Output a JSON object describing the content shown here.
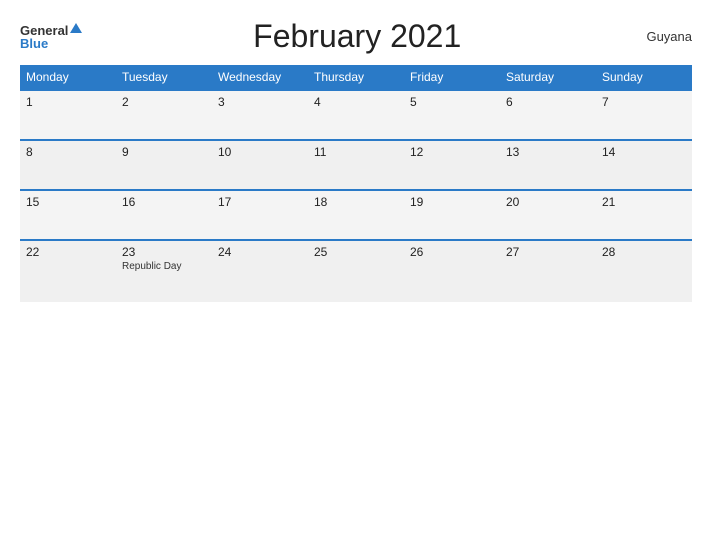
{
  "header": {
    "logo_general": "General",
    "logo_blue": "Blue",
    "title": "February 2021",
    "country": "Guyana"
  },
  "weekdays": [
    "Monday",
    "Tuesday",
    "Wednesday",
    "Thursday",
    "Friday",
    "Saturday",
    "Sunday"
  ],
  "weeks": [
    [
      {
        "day": "1",
        "holiday": ""
      },
      {
        "day": "2",
        "holiday": ""
      },
      {
        "day": "3",
        "holiday": ""
      },
      {
        "day": "4",
        "holiday": ""
      },
      {
        "day": "5",
        "holiday": ""
      },
      {
        "day": "6",
        "holiday": ""
      },
      {
        "day": "7",
        "holiday": ""
      }
    ],
    [
      {
        "day": "8",
        "holiday": ""
      },
      {
        "day": "9",
        "holiday": ""
      },
      {
        "day": "10",
        "holiday": ""
      },
      {
        "day": "11",
        "holiday": ""
      },
      {
        "day": "12",
        "holiday": ""
      },
      {
        "day": "13",
        "holiday": ""
      },
      {
        "day": "14",
        "holiday": ""
      }
    ],
    [
      {
        "day": "15",
        "holiday": ""
      },
      {
        "day": "16",
        "holiday": ""
      },
      {
        "day": "17",
        "holiday": ""
      },
      {
        "day": "18",
        "holiday": ""
      },
      {
        "day": "19",
        "holiday": ""
      },
      {
        "day": "20",
        "holiday": ""
      },
      {
        "day": "21",
        "holiday": ""
      }
    ],
    [
      {
        "day": "22",
        "holiday": ""
      },
      {
        "day": "23",
        "holiday": "Republic Day"
      },
      {
        "day": "24",
        "holiday": ""
      },
      {
        "day": "25",
        "holiday": ""
      },
      {
        "day": "26",
        "holiday": ""
      },
      {
        "day": "27",
        "holiday": ""
      },
      {
        "day": "28",
        "holiday": ""
      }
    ]
  ]
}
